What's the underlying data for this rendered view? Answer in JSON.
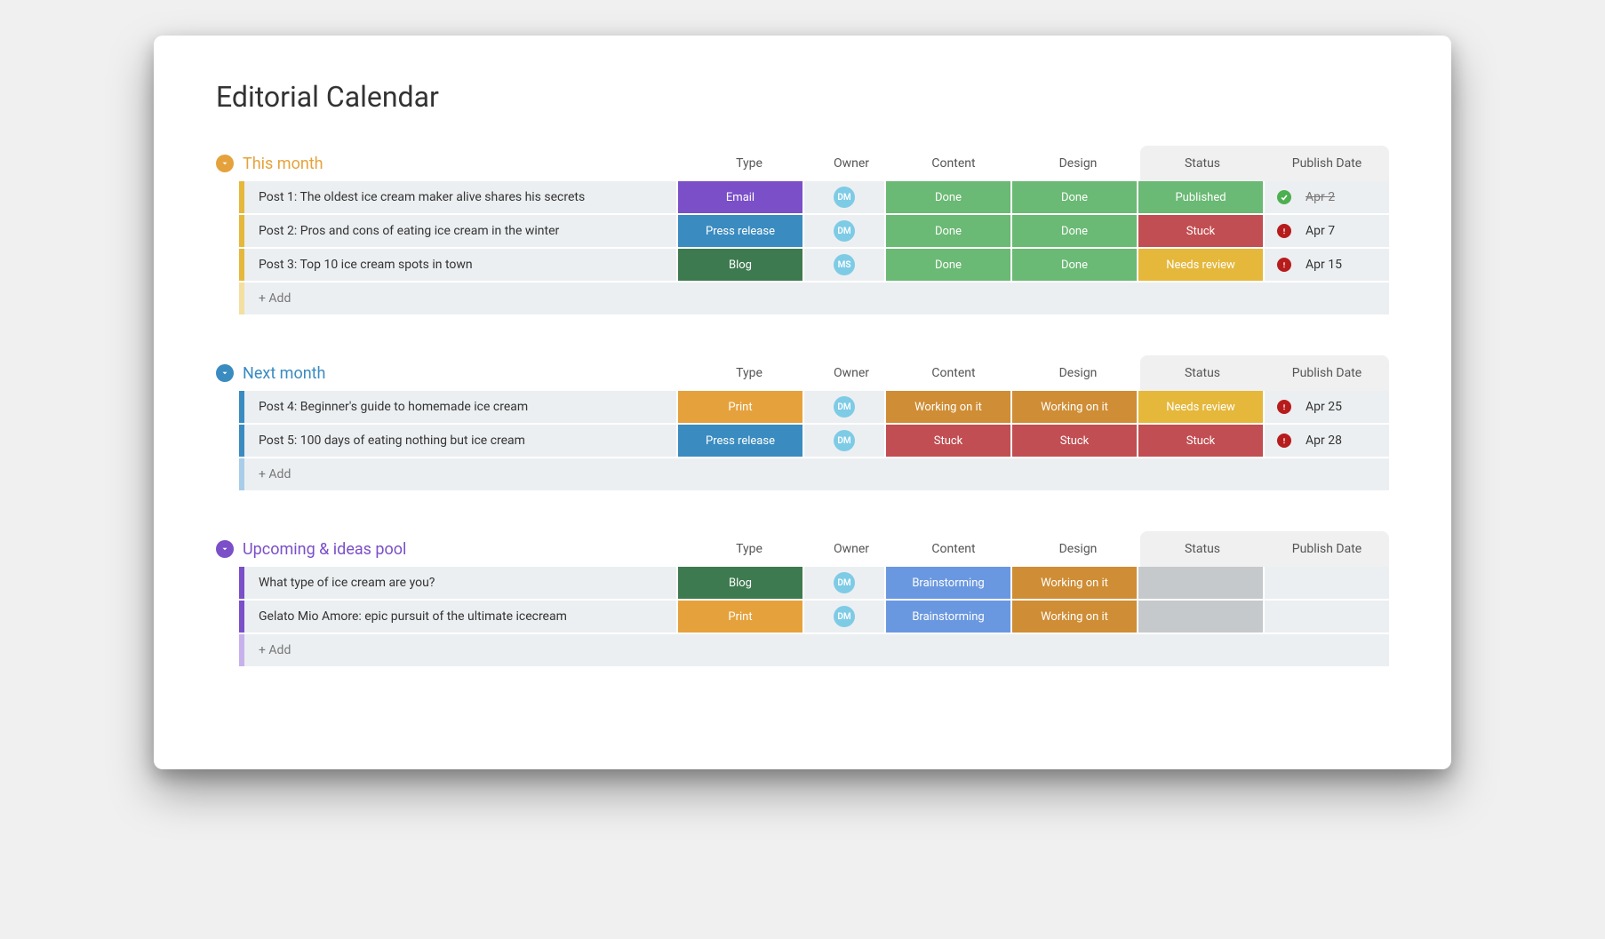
{
  "title": "Editorial Calendar",
  "columns": [
    "Type",
    "Owner",
    "Content",
    "Design",
    "Status",
    "Publish Date"
  ],
  "addLabel": "+ Add",
  "groups": [
    {
      "key": "g0",
      "title": "This month",
      "accent": "yellow",
      "collapseBg": "#e5a23c",
      "rows": [
        {
          "name": "Post 1: The oldest ice cream maker alive shares his secrets",
          "type": "Email",
          "typeColor": "purple",
          "owner": "DM",
          "content": "Done",
          "contentColor": "green",
          "design": "Done",
          "designColor": "green",
          "status": "Published",
          "statusColor": "green",
          "dateIcon": "check",
          "date": "Apr 2",
          "dateStrike": true
        },
        {
          "name": "Post 2: Pros and cons of eating ice cream in the winter",
          "type": "Press release",
          "typeColor": "blue",
          "owner": "DM",
          "content": "Done",
          "contentColor": "green",
          "design": "Done",
          "designColor": "green",
          "status": "Stuck",
          "statusColor": "red",
          "dateIcon": "alert",
          "date": "Apr 7",
          "dateStrike": false
        },
        {
          "name": "Post 3: Top 10 ice cream spots in town",
          "type": "Blog",
          "typeColor": "dgreen",
          "owner": "MS",
          "content": "Done",
          "contentColor": "green",
          "design": "Done",
          "designColor": "green",
          "status": "Needs review",
          "statusColor": "yellow",
          "dateIcon": "alert",
          "date": "Apr 15",
          "dateStrike": false
        }
      ]
    },
    {
      "key": "g1",
      "title": "Next month",
      "accent": "blue",
      "collapseBg": "#3a8bc0",
      "rows": [
        {
          "name": "Post 4: Beginner's guide to homemade ice cream",
          "type": "Print",
          "typeColor": "orange",
          "owner": "DM",
          "content": "Working on it",
          "contentColor": "dorange",
          "design": "Working on it",
          "designColor": "dorange",
          "status": "Needs review",
          "statusColor": "yellow",
          "dateIcon": "alert",
          "date": "Apr 25",
          "dateStrike": false
        },
        {
          "name": "Post 5: 100 days of eating nothing but ice cream",
          "type": "Press release",
          "typeColor": "blue",
          "owner": "DM",
          "content": "Stuck",
          "contentColor": "red",
          "design": "Stuck",
          "designColor": "red",
          "status": "Stuck",
          "statusColor": "red",
          "dateIcon": "alert",
          "date": "Apr 28",
          "dateStrike": false
        }
      ]
    },
    {
      "key": "g2",
      "title": "Upcoming & ideas pool",
      "accent": "purple",
      "collapseBg": "#7a4fc8",
      "rows": [
        {
          "name": "What type of ice cream are you?",
          "type": "Blog",
          "typeColor": "dgreen",
          "owner": "DM",
          "content": "Brainstorming",
          "contentColor": "lblue",
          "design": "Working on it",
          "designColor": "dorange",
          "status": "",
          "statusColor": "grey",
          "dateIcon": "",
          "date": "",
          "dateStrike": false
        },
        {
          "name": "Gelato Mio Amore: epic pursuit of the ultimate icecream",
          "type": "Print",
          "typeColor": "orange",
          "owner": "DM",
          "content": "Brainstorming",
          "contentColor": "lblue",
          "design": "Working on it",
          "designColor": "dorange",
          "status": "",
          "statusColor": "grey",
          "dateIcon": "",
          "date": "",
          "dateStrike": false
        }
      ]
    }
  ]
}
